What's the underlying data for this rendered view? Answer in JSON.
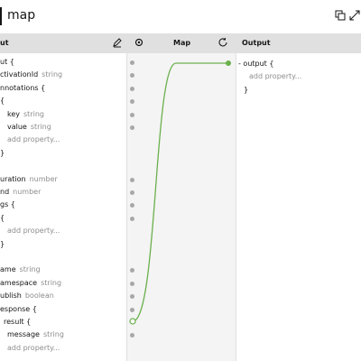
{
  "window": {
    "title": "map"
  },
  "header": {
    "input_label": "ut",
    "map_label": "Map",
    "output_label": "Output"
  },
  "colors": {
    "connector": "#6ab04c",
    "header_bg": "#e0e0e0",
    "map_bg": "#f4f4f4"
  },
  "input_rows": [
    {
      "key": "ut {",
      "type": ""
    },
    {
      "key": "ctivationId",
      "type": "string"
    },
    {
      "key": "nnotations {",
      "type": ""
    },
    {
      "key": "{",
      "type": ""
    },
    {
      "key": "key",
      "type": "string"
    },
    {
      "key": "value",
      "type": "string"
    },
    {
      "key": "add property...",
      "type": "",
      "muted": true
    },
    {
      "key": "}",
      "type": ""
    },
    {
      "key": "",
      "type": ""
    },
    {
      "key": "uration",
      "type": "number"
    },
    {
      "key": "nd",
      "type": "number"
    },
    {
      "key": "gs {",
      "type": ""
    },
    {
      "key": "{",
      "type": ""
    },
    {
      "key": "add property...",
      "type": "",
      "muted": true
    },
    {
      "key": "}",
      "type": ""
    },
    {
      "key": "",
      "type": ""
    },
    {
      "key": "ame",
      "type": "string"
    },
    {
      "key": "amespace",
      "type": "string"
    },
    {
      "key": "ublish",
      "type": "boolean"
    },
    {
      "key": "esponse {",
      "type": ""
    },
    {
      "key": "result {",
      "type": ""
    },
    {
      "key": "message",
      "type": "string"
    },
    {
      "key": "add property...",
      "type": "",
      "muted": true
    }
  ],
  "output_rows": [
    {
      "key": "- output {"
    },
    {
      "key": "add property...",
      "muted": true
    },
    {
      "key": "}"
    }
  ]
}
